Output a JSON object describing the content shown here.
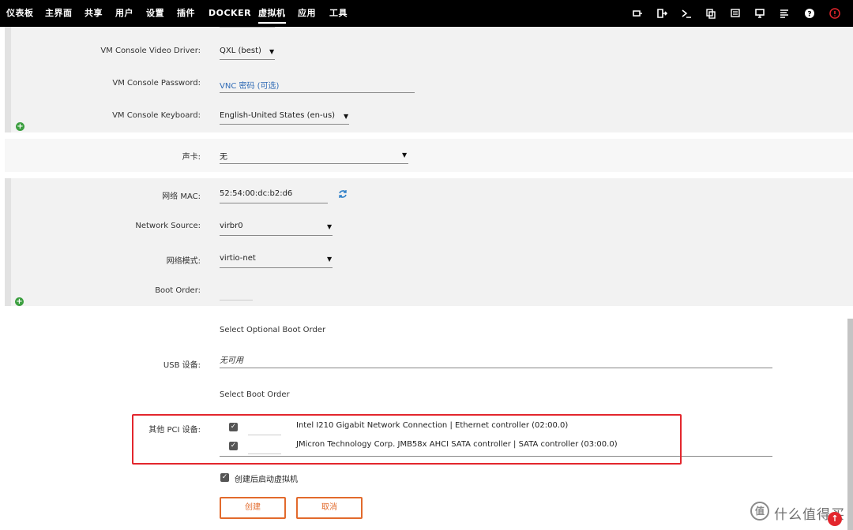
{
  "nav": {
    "items": [
      {
        "label": "仪表板"
      },
      {
        "label": "主界面"
      },
      {
        "label": "共享"
      },
      {
        "label": "用户"
      },
      {
        "label": "设置"
      },
      {
        "label": "插件"
      },
      {
        "label": "DOCKER"
      },
      {
        "label": "虚拟机",
        "active": true
      },
      {
        "label": "应用"
      },
      {
        "label": "工具"
      }
    ],
    "icons": [
      "feedback-icon",
      "logout-icon",
      "terminal-icon",
      "copy-icon",
      "notes-icon",
      "display-icon",
      "log-icon",
      "help-icon",
      "info-icon"
    ]
  },
  "vm_console": {
    "video_driver_label": "VM Console Video Driver:",
    "video_driver_value": "QXL (best)",
    "password_label": "VM Console Password:",
    "password_placeholder": "VNC 密码 (可选)",
    "keyboard_label": "VM Console Keyboard:",
    "keyboard_value": "English-United States (en-us)"
  },
  "sound": {
    "label": "声卡:",
    "value": "无"
  },
  "network": {
    "mac_label": "网络 MAC:",
    "mac_value": "52:54:00:dc:b2:d6",
    "source_label": "Network Source:",
    "source_value": "virbr0",
    "model_label": "网络模式:",
    "model_value": "virtio-net",
    "boot_order_label": "Boot Order:"
  },
  "usb": {
    "optional_boot_hint": "Select  Optional  Boot Order",
    "label": "USB 设备:",
    "value": "无可用",
    "boot_hint": "Select  Boot Order"
  },
  "pci": {
    "label": "其他 PCI 设备:",
    "devices": [
      {
        "name": "Intel I210 Gigabit Network Connection | Ethernet controller (02:00.0)",
        "checked": true
      },
      {
        "name": "JMicron Technology Corp. JMB58x AHCI SATA controller | SATA controller (03:00.0)",
        "checked": true
      }
    ]
  },
  "autostart": {
    "label": "创建后启动虚拟机",
    "checked": true
  },
  "buttons": {
    "create": "创建",
    "cancel": "取消"
  },
  "watermark": {
    "logo": "值",
    "text": "什么值得买"
  },
  "colors": {
    "accent": "#e26a2c",
    "highlight_box": "#e3262d",
    "link": "#2f6ab5",
    "add_icon": "#3c9f40"
  }
}
